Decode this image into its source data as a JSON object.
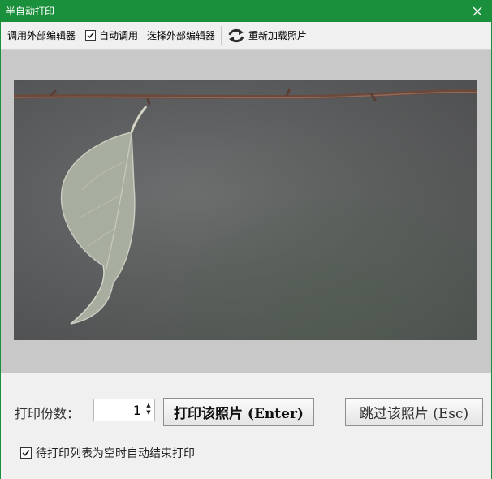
{
  "window": {
    "title": "半自动打印"
  },
  "toolbar": {
    "external_editor_label": "调用外部编辑器",
    "auto_call_label": "自动调用",
    "auto_call_checked": true,
    "select_editor_label": "选择外部编辑器",
    "reload_label": "重新加载照片",
    "reload_icon": "refresh-icon"
  },
  "print": {
    "copies_label": "打印份数：",
    "copies_value": "1",
    "print_button_label": "打印该照片 (Enter)",
    "skip_button_label": "跳过该照片 (Esc)",
    "auto_end_label": "待打印列表为空时自动结束打印",
    "auto_end_checked": true
  },
  "colors": {
    "titlebar": "#1a8f3c",
    "reload_icon": "#2b2b2b"
  }
}
